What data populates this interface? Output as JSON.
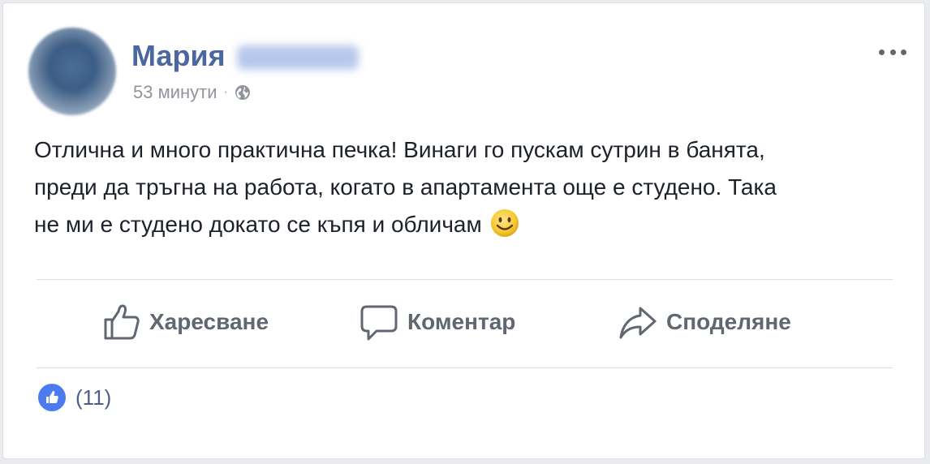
{
  "post": {
    "author_first_name": "Мария",
    "time": "53 минути",
    "separator": "·",
    "privacy_icon": "globe-icon",
    "menu_icon": "more-options-icon",
    "text_lines": [
      "Отлична и много практична печка! Винаги го пускам сутрин в банята,",
      "преди да тръгна на работа, когато в апартамента още е студено. Така",
      "не ми е студено докато се къпя и обличам"
    ],
    "emoji": "slightly-smiling-face-icon"
  },
  "actions": {
    "like_label": "Харесване",
    "comment_label": "Коментар",
    "share_label": "Споделяне"
  },
  "reactions": {
    "icon": "like-badge-icon",
    "count_label": "(11)"
  },
  "colors": {
    "author": "#4b67a1",
    "muted": "#90949c",
    "action": "#606770",
    "like_badge": "#4b7bef",
    "text": "#1d2129"
  }
}
